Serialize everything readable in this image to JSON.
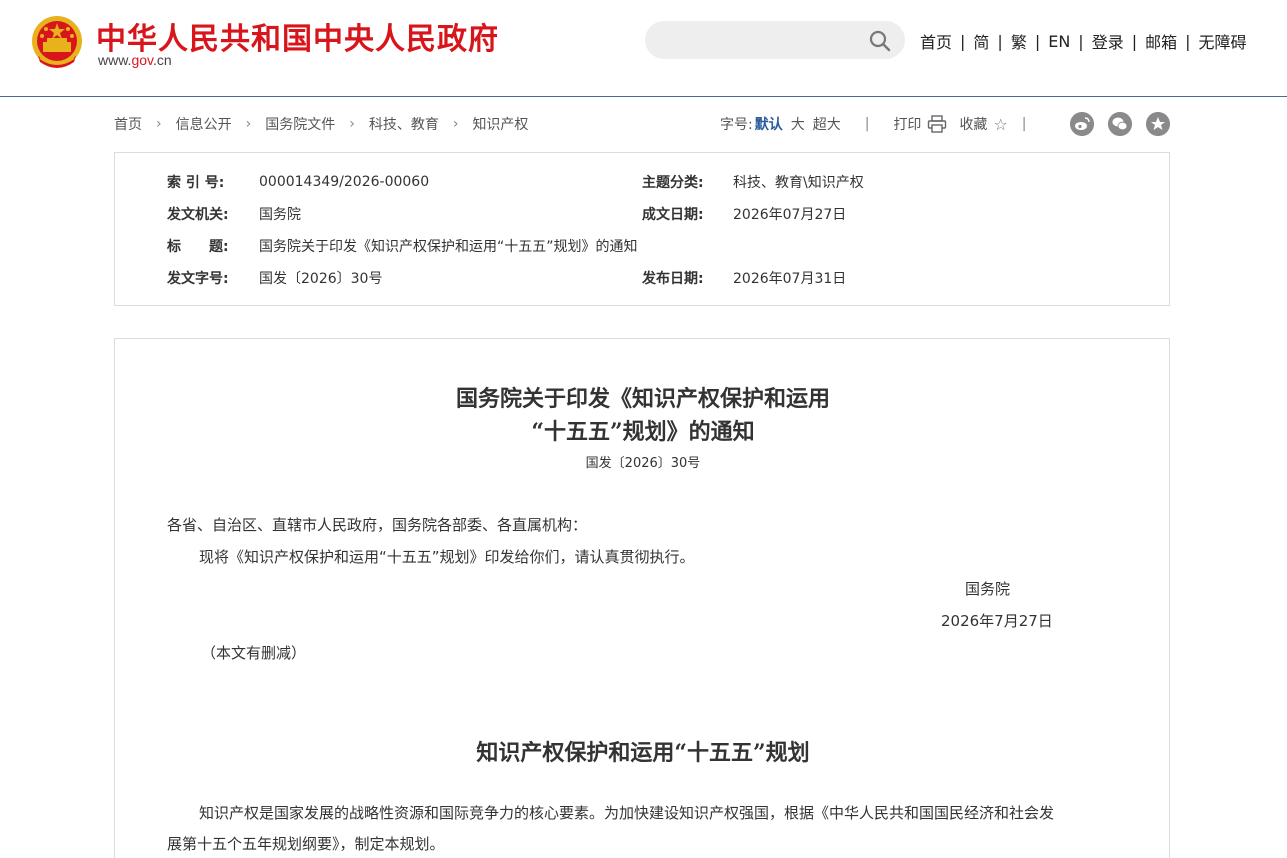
{
  "header": {
    "site_title": "中华人民共和国中央人民政府",
    "domain_prefix": "www.",
    "domain_highlight": "gov",
    "domain_suffix": ".cn",
    "search": {
      "placeholder": "",
      "value": ""
    },
    "nav": [
      "首页",
      "简",
      "繁",
      "EN",
      "登录",
      "邮箱",
      "无障碍"
    ],
    "colors": {
      "brand_red": "#d8151b",
      "divider_blue": "#4a6a96"
    }
  },
  "breadcrumb": [
    "首页",
    "信息公开",
    "国务院文件",
    "科技、教育",
    "知识产权"
  ],
  "tools": {
    "font_size_label": "字号:",
    "font_default": "默认",
    "font_large": "大",
    "font_xlarge": "超大",
    "print": "打印",
    "favorite": "收藏"
  },
  "social_icons": [
    "weibo-icon",
    "wechat-icon",
    "star-share-icon"
  ],
  "meta": {
    "index_label": "索 引 号:",
    "index_value": "000014349/2026-00060",
    "category_label": "主题分类:",
    "category_value": "科技、教育\\知识产权",
    "issuer_label": "发文机关:",
    "issuer_value": "国务院",
    "written_date_label": "成文日期:",
    "written_date_value": "2026年07月27日",
    "title_label": "标　　题:",
    "title_value": "国务院关于印发《知识产权保护和运用“十五五”规划》的通知",
    "doc_no_label": "发文字号:",
    "doc_no_value": "国发〔2026〕30号",
    "publish_date_label": "发布日期:",
    "publish_date_value": "2026年07月31日"
  },
  "document": {
    "title_line1": "国务院关于印发《知识产权保护和运用",
    "title_line2": "“十五五”规划》的通知",
    "doc_number": "国发〔2026〕30号",
    "salutation": "各省、自治区、直辖市人民政府，国务院各部委、各直属机构：",
    "body1": "现将《知识产权保护和运用“十五五”规划》印发给你们，请认真贯彻执行。",
    "signature": "国务院",
    "sign_date": "2026年7月27日",
    "note": "（本文有删减）",
    "plan_title": "知识产权保护和运用“十五五”规划",
    "plan_para_line1": "知识产权是国家发展的战略性资源和国际竞争力的核心要素。为加快建设知识产权强国，根据《中华人民共和国国民经济和社会发",
    "plan_para_line2": "展第十五个五年规划纲要》，制定本规划。"
  }
}
